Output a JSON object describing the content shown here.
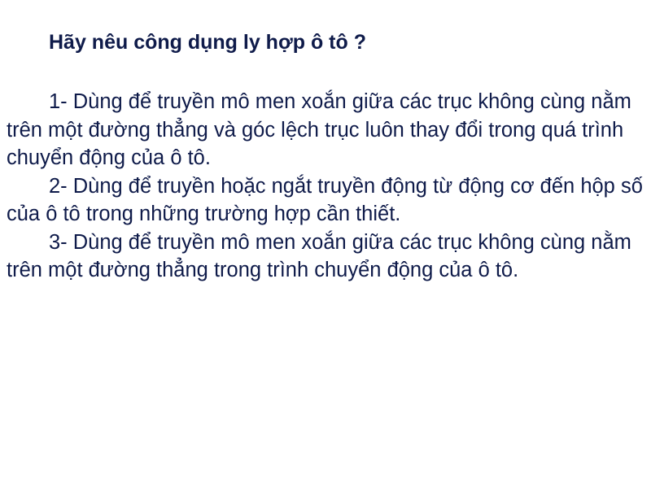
{
  "question": "Hãy nêu công dụng ly hợp ô tô ?",
  "answers": [
    "1- Dùng để truyền mô men xoắn giữa các trục không cùng nằm trên một đường thẳng và góc lệch trục luôn thay đổi trong quá trình chuyển động của ô tô.",
    "2- Dùng để truyền hoặc ngắt truyền động từ động cơ đến hộp số của ô tô trong những trường hợp cần thiết.",
    "3- Dùng để truyền mô men xoắn giữa các trục không cùng nằm trên một đường thẳng trong trình chuyển động của ô tô."
  ]
}
